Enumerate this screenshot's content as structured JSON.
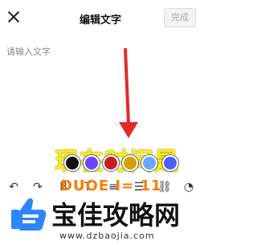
{
  "header": {
    "title": "编辑文字",
    "done_label": "完成"
  },
  "editor": {
    "placeholder": "请输入文字",
    "overlay_text": "现在时间是",
    "orange_text": "DUOE I= 11"
  },
  "colors": {
    "swatches": [
      "#111111",
      "#6a44ff",
      "#c81d1d",
      "#d59f00",
      "#6aa7ff",
      "#4b5dff"
    ],
    "accent_arrow": "#e12a2a"
  },
  "toolbar": {
    "items": [
      "undo",
      "redo",
      "bold",
      "text",
      "align",
      "list",
      "link",
      "more"
    ]
  },
  "watermark": {
    "main": "宝佳攻略网",
    "url": "www.dzbaojia.com"
  }
}
